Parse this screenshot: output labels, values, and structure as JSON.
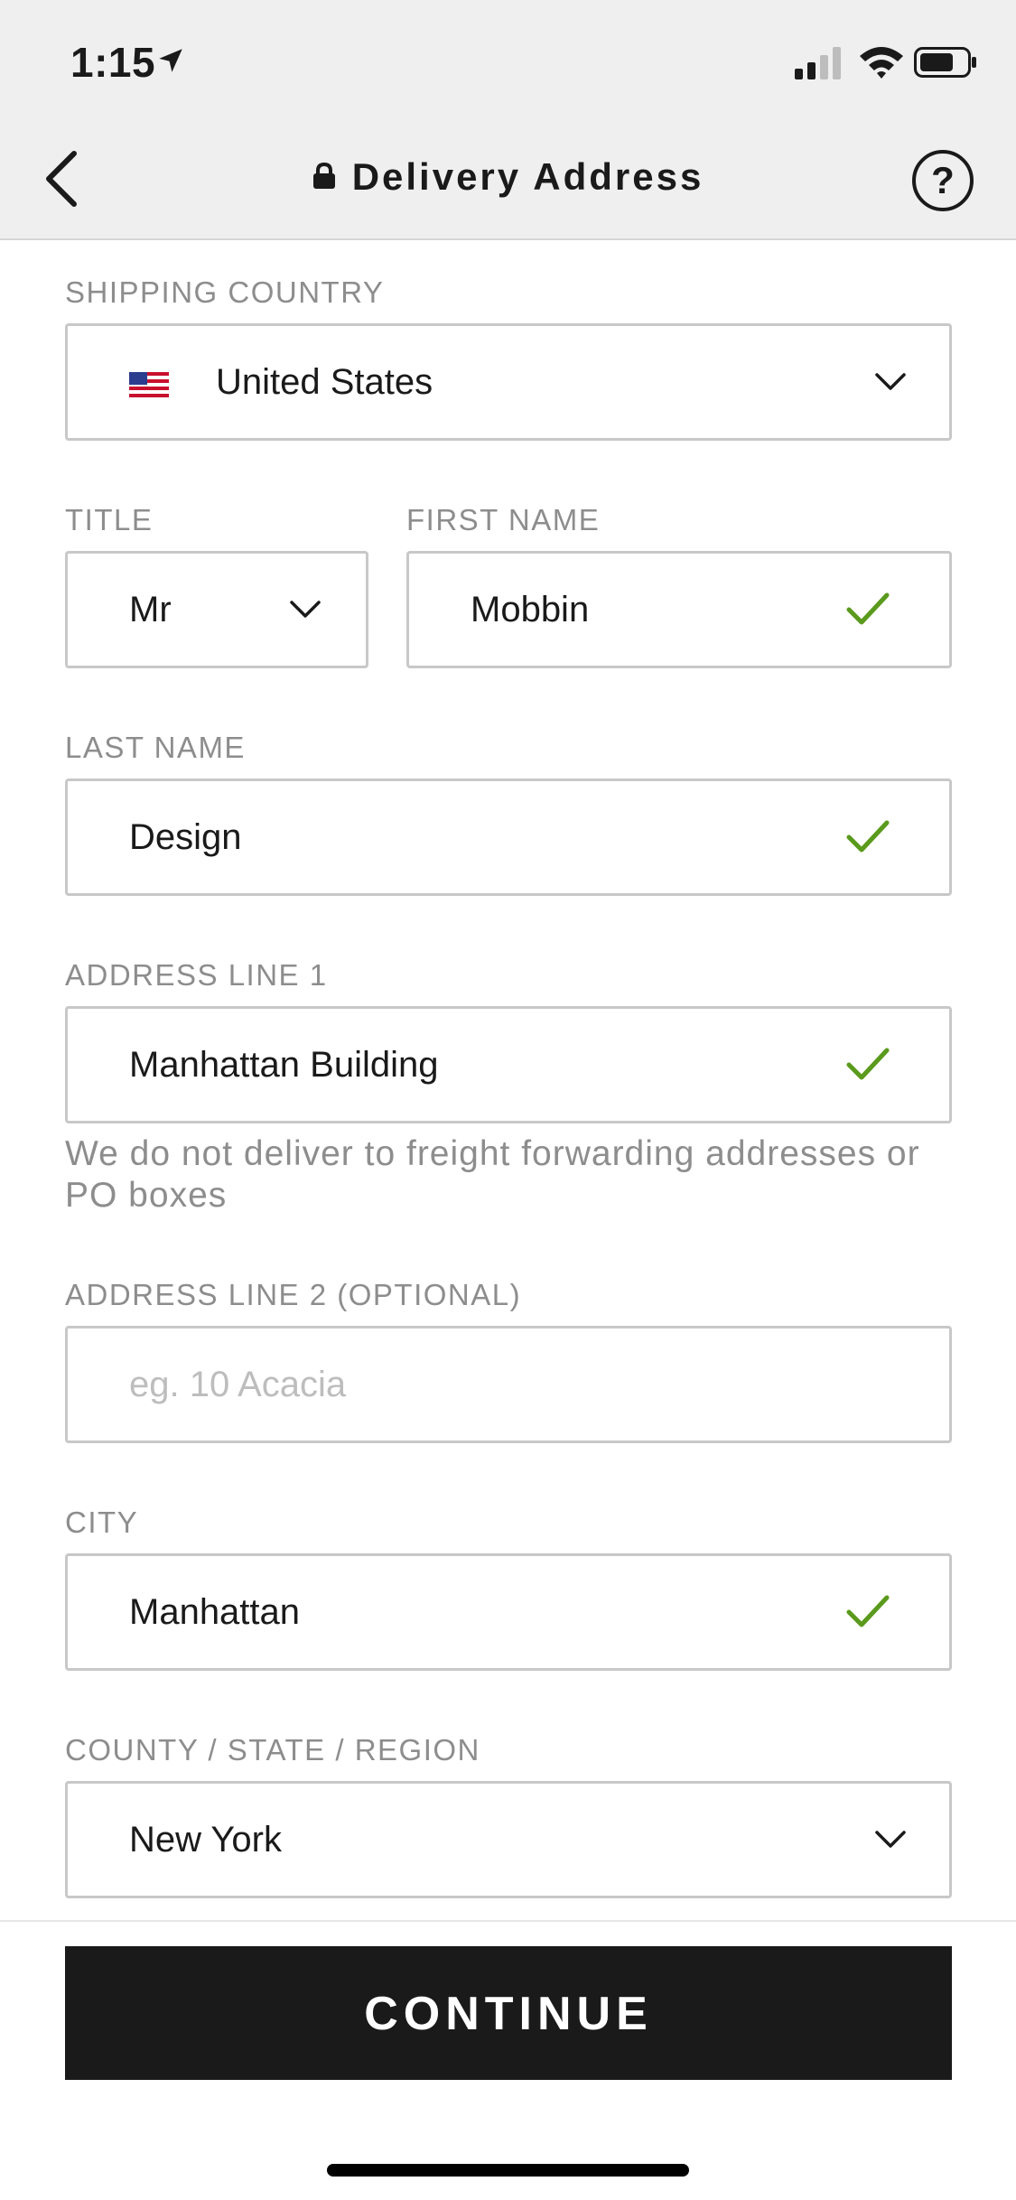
{
  "status_bar": {
    "time": "1:15"
  },
  "nav": {
    "title": "Delivery Address",
    "help": "?"
  },
  "form": {
    "shipping_country": {
      "label": "SHIPPING COUNTRY",
      "value": "United States"
    },
    "title": {
      "label": "TITLE",
      "value": "Mr"
    },
    "first_name": {
      "label": "FIRST NAME",
      "value": "Mobbin"
    },
    "last_name": {
      "label": "LAST NAME",
      "value": "Design"
    },
    "address_line_1": {
      "label": "ADDRESS LINE 1",
      "value": "Manhattan Building",
      "note": "We do not deliver to freight forwarding addresses or PO boxes"
    },
    "address_line_2": {
      "label": "ADDRESS LINE 2 (OPTIONAL)",
      "placeholder": "eg. 10 Acacia"
    },
    "city": {
      "label": "CITY",
      "value": "Manhattan"
    },
    "region": {
      "label": "COUNTY / STATE / REGION",
      "value": "New York"
    }
  },
  "continue_button": {
    "label": "CONTINUE"
  },
  "colors": {
    "check": "#5a9a1c",
    "button_bg": "#1a1a1a",
    "label": "#8d8d8d",
    "border": "#c8c8c8"
  }
}
